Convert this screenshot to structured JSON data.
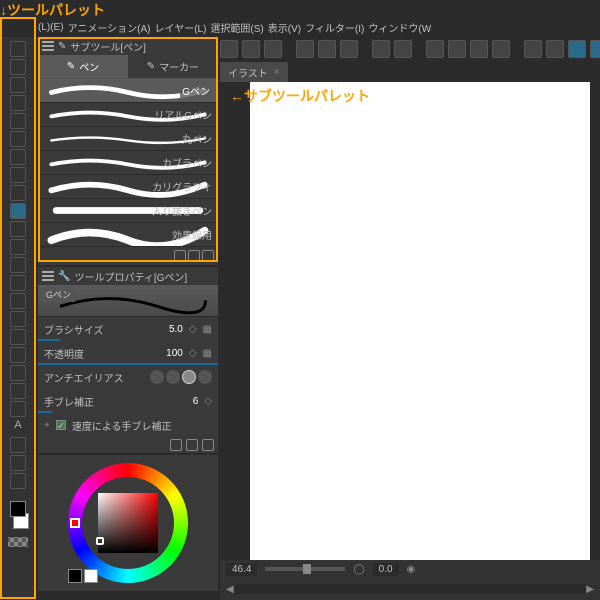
{
  "annotations": {
    "top": "↓ツールパレット",
    "side": "←サブツールパレット"
  },
  "menu": {
    "items": [
      "(L)(E)",
      "アニメーション(A)",
      "レイヤー(L)",
      "選択範囲(S)",
      "表示(V)",
      "フィルター(I)",
      "ウィンドウ(W"
    ]
  },
  "subtool": {
    "title": "サブツール[ペン]",
    "tabs": [
      {
        "label": "ペン",
        "active": true
      },
      {
        "label": "マーカー",
        "active": false
      }
    ],
    "items": [
      {
        "label": "Gペン",
        "selected": true
      },
      {
        "label": "リアルGペン",
        "selected": false
      },
      {
        "label": "丸ペン",
        "selected": false
      },
      {
        "label": "カブラペン",
        "selected": false
      },
      {
        "label": "カリグラフィ",
        "selected": false
      },
      {
        "label": "入り抜きペン",
        "selected": false
      },
      {
        "label": "効果線用",
        "selected": false
      }
    ]
  },
  "properties": {
    "title": "ツールプロパティ[Gペン]",
    "preview_label": "Gペン",
    "rows": {
      "brush_size_label": "ブラシサイズ",
      "brush_size_value": "5.0",
      "opacity_label": "不透明度",
      "opacity_value": "100",
      "antialias_label": "アンチエイリアス",
      "stabilize_label": "手ブレ補正",
      "stabilize_value": "6",
      "speed_stabilize_label": "速度による手ブレ補正"
    }
  },
  "canvas": {
    "tab_label": "イラスト",
    "close": "×"
  },
  "status": {
    "zoom": "46.4",
    "rotation": "0.0"
  },
  "colors": {
    "accent": "#ffa500",
    "bg": "#2b2b2b",
    "panel": "#3a3a3a"
  }
}
